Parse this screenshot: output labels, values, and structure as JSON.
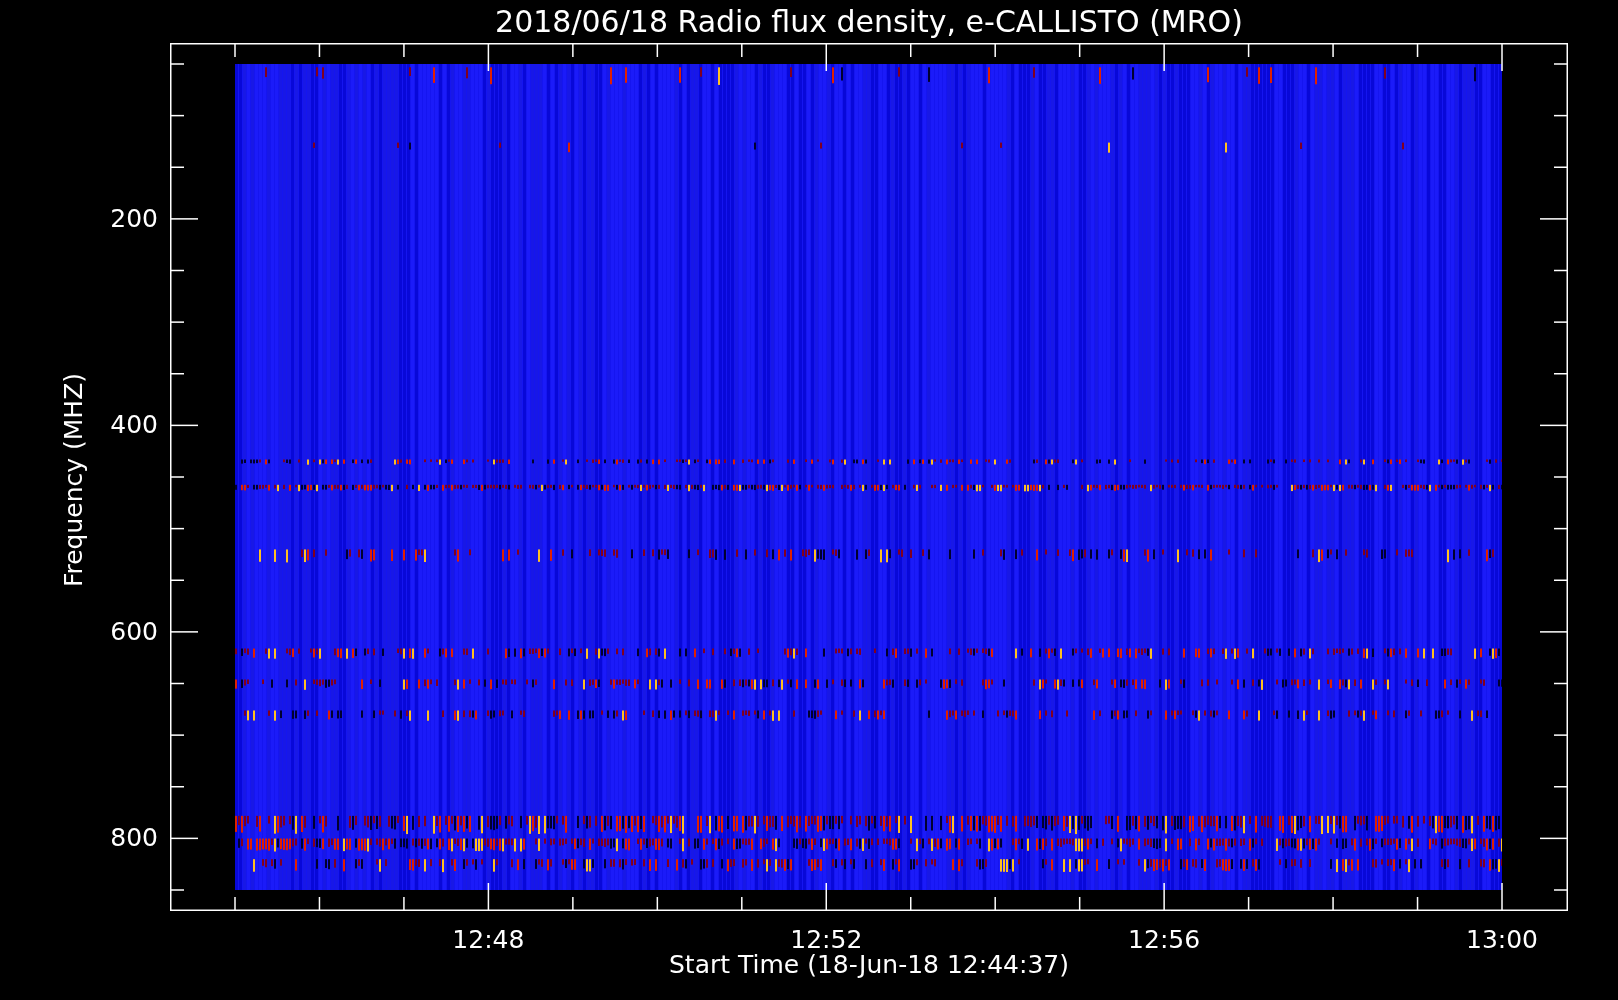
{
  "title": "2018/06/18  Radio flux density, e-CALLISTO (MRO)",
  "y_axis": {
    "label": "Frequency (MHZ)",
    "ticks": [
      "200",
      "400",
      "600",
      "800"
    ]
  },
  "x_axis": {
    "label": "Start Time (18-Jun-18 12:44:37)",
    "ticks": [
      "12:48",
      "12:52",
      "12:56",
      "13:00"
    ]
  }
}
